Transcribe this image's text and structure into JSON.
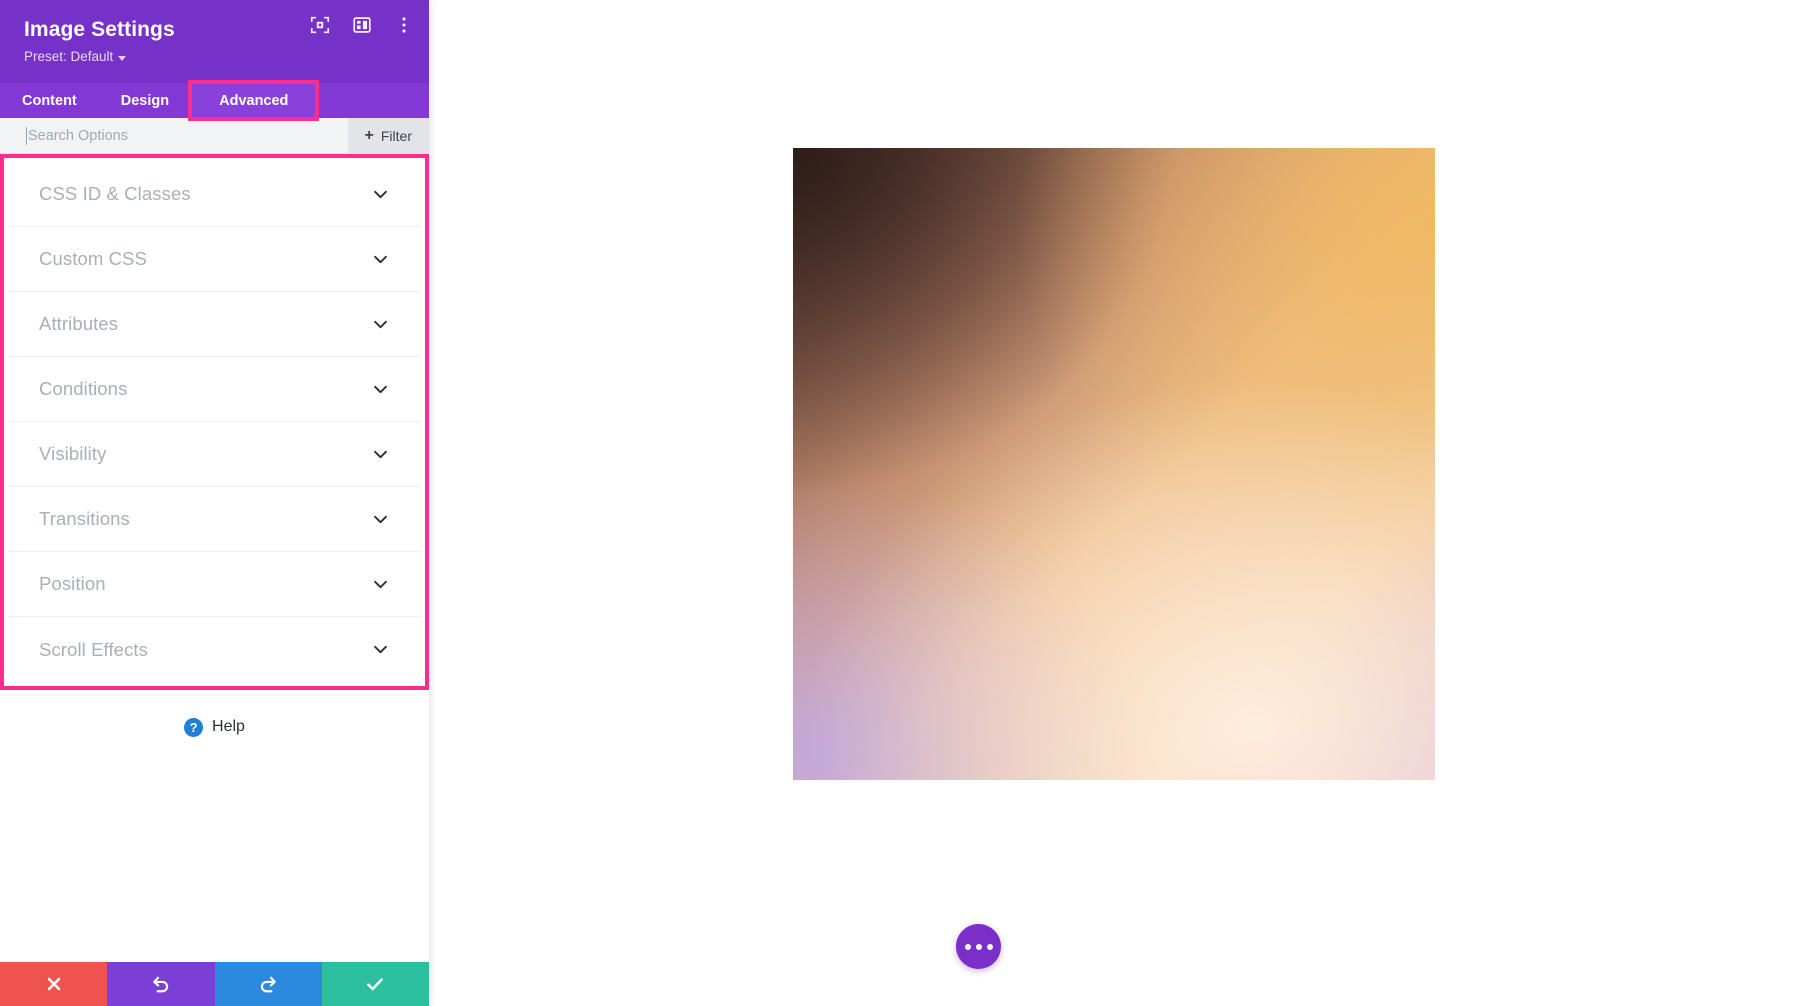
{
  "panel": {
    "title": "Image Settings",
    "preset_label": "Preset: Default",
    "header_icons": [
      {
        "name": "focus-target-icon",
        "glyph": "focus"
      },
      {
        "name": "layout-panel-icon",
        "glyph": "panel"
      },
      {
        "name": "more-vertical-icon",
        "glyph": "kebab"
      }
    ],
    "tabs": [
      {
        "label": "Content",
        "active": false
      },
      {
        "label": "Design",
        "active": false
      },
      {
        "label": "Advanced",
        "active": true
      }
    ],
    "search": {
      "value": "",
      "placeholder": "Search Options",
      "filter_label": "Filter",
      "filter_plus": "+"
    },
    "sections": [
      {
        "label": "CSS ID & Classes",
        "expanded": false
      },
      {
        "label": "Custom CSS",
        "expanded": false
      },
      {
        "label": "Attributes",
        "expanded": false
      },
      {
        "label": "Conditions",
        "expanded": false
      },
      {
        "label": "Visibility",
        "expanded": false
      },
      {
        "label": "Transitions",
        "expanded": false
      },
      {
        "label": "Position",
        "expanded": false
      },
      {
        "label": "Scroll Effects",
        "expanded": false
      }
    ],
    "help": {
      "label": "Help",
      "icon_glyph": "?"
    },
    "actions": [
      {
        "name": "cancel",
        "icon": "close-icon",
        "color": "#ef5350"
      },
      {
        "name": "undo",
        "icon": "undo-icon",
        "color": "#7c3fd6"
      },
      {
        "name": "redo",
        "icon": "redo-icon",
        "color": "#2b8ade"
      },
      {
        "name": "save",
        "icon": "check-icon",
        "color": "#2bbfa0"
      }
    ]
  },
  "canvas": {
    "image_module": {
      "alt": "gradient-image",
      "corner_colors": {
        "top_left": "#2e1c18",
        "top_right": "#eaa94f",
        "bottom_left": "#c0a6e2",
        "bottom_right": "#e6b894"
      }
    },
    "fab": {
      "name": "page-settings-fab",
      "icon": "more-horizontal-icon",
      "color": "#7b2fc8"
    }
  },
  "highlights": {
    "color": "#fb2e8e",
    "targets": [
      "Advanced",
      "section-list"
    ]
  }
}
